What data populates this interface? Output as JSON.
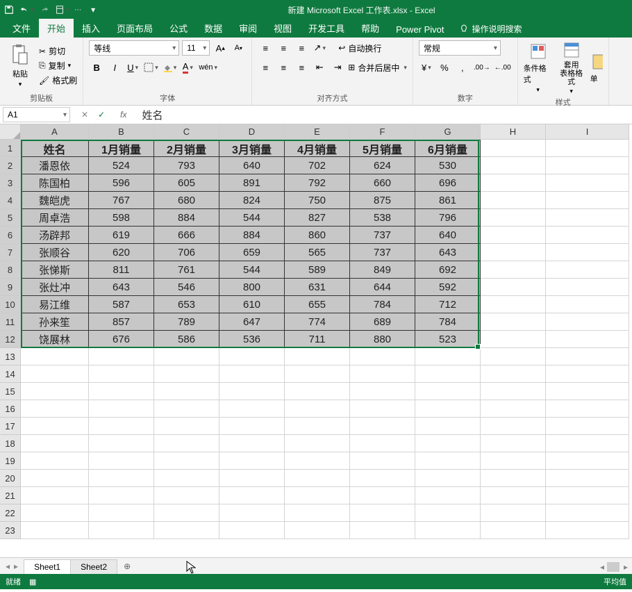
{
  "title": "新建 Microsoft Excel 工作表.xlsx  -  Excel",
  "tabs": [
    "文件",
    "开始",
    "插入",
    "页面布局",
    "公式",
    "数据",
    "审阅",
    "视图",
    "开发工具",
    "帮助",
    "Power Pivot"
  ],
  "tell_me": "操作说明搜索",
  "clipboard": {
    "cut": "剪切",
    "copy": "复制",
    "paint": "格式刷",
    "paste": "粘贴",
    "label": "剪贴板"
  },
  "font": {
    "name": "等线",
    "size": "11",
    "label": "字体"
  },
  "align": {
    "wrap": "自动换行",
    "merge": "合并后居中",
    "label": "对齐方式"
  },
  "number": {
    "format": "常规",
    "label": "数字"
  },
  "styles": {
    "cond": "条件格式",
    "table": "套用\n表格格式",
    "cell_prefix": "单",
    "label": "样式"
  },
  "namebox": "A1",
  "formula": "姓名",
  "columns": [
    "A",
    "B",
    "C",
    "D",
    "E",
    "F",
    "G",
    "H",
    "I"
  ],
  "chart_data": {
    "type": "table",
    "headers": [
      "姓名",
      "1月销量",
      "2月销量",
      "3月销量",
      "4月销量",
      "5月销量",
      "6月销量"
    ],
    "rows": [
      [
        "潘恩依",
        524,
        793,
        640,
        702,
        624,
        530
      ],
      [
        "陈国柏",
        596,
        605,
        891,
        792,
        660,
        696
      ],
      [
        "魏皑虎",
        767,
        680,
        824,
        750,
        875,
        861
      ],
      [
        "周卓浩",
        598,
        884,
        544,
        827,
        538,
        796
      ],
      [
        "汤辟邦",
        619,
        666,
        884,
        860,
        737,
        640
      ],
      [
        "张顺谷",
        620,
        706,
        659,
        565,
        737,
        643
      ],
      [
        "张悌斯",
        811,
        761,
        544,
        589,
        849,
        692
      ],
      [
        "张灶冲",
        643,
        546,
        800,
        631,
        644,
        592
      ],
      [
        "易江维",
        587,
        653,
        610,
        655,
        784,
        712
      ],
      [
        "孙来笙",
        857,
        789,
        647,
        774,
        689,
        784
      ],
      [
        "饶展林",
        676,
        586,
        536,
        711,
        880,
        523
      ]
    ]
  },
  "sheets": [
    "Sheet1",
    "Sheet2"
  ],
  "status": {
    "ready": "就绪",
    "avg_label": "平均值"
  }
}
